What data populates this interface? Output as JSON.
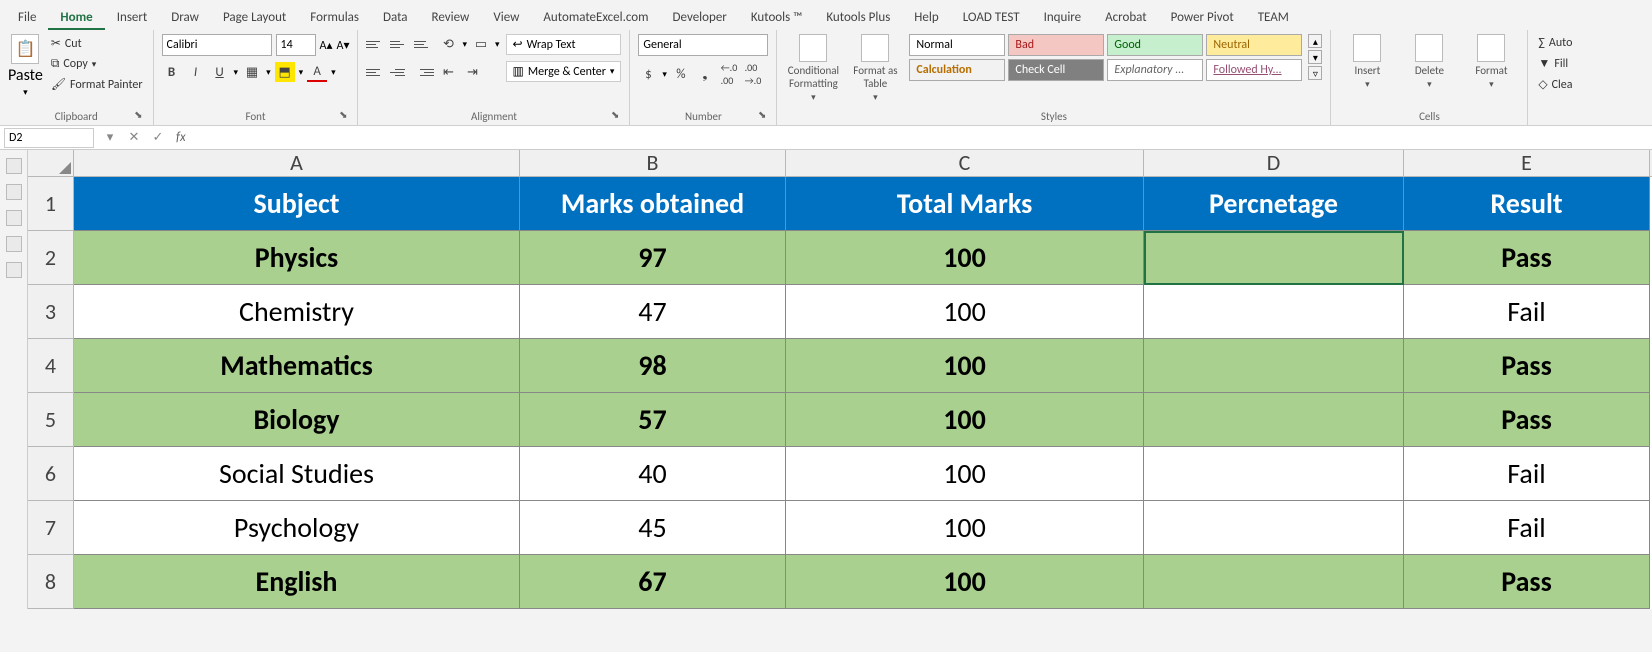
{
  "tabs": [
    "File",
    "Home",
    "Insert",
    "Draw",
    "Page Layout",
    "Formulas",
    "Data",
    "Review",
    "View",
    "AutomateExcel.com",
    "Developer",
    "Kutools ™",
    "Kutools Plus",
    "Help",
    "LOAD TEST",
    "Inquire",
    "Acrobat",
    "Power Pivot",
    "TEAM"
  ],
  "active_tab": "Home",
  "clipboard": {
    "paste": "Paste",
    "cut": "Cut",
    "copy": "Copy",
    "painter": "Format Painter",
    "label": "Clipboard"
  },
  "font": {
    "name": "Calibri",
    "size": "14",
    "label": "Font"
  },
  "alignment": {
    "wrap": "Wrap Text",
    "merge": "Merge & Center",
    "label": "Alignment"
  },
  "number": {
    "format": "General",
    "label": "Number"
  },
  "styles": {
    "cond": "Conditional Formatting",
    "fmt_table": "Format as Table",
    "normal": "Normal",
    "bad": "Bad",
    "good": "Good",
    "neutral": "Neutral",
    "calc": "Calculation",
    "check": "Check Cell",
    "expl": "Explanatory ...",
    "follow": "Followed Hy...",
    "label": "Styles"
  },
  "cells": {
    "insert": "Insert",
    "delete": "Delete",
    "format": "Format",
    "label": "Cells"
  },
  "editing": {
    "autosum": "Auto",
    "fill": "Fill",
    "clear": "Clea"
  },
  "namebox": "D2",
  "formula": "",
  "columns": [
    "A",
    "B",
    "C",
    "D",
    "E"
  ],
  "header_row": [
    "Subject",
    "Marks obtained",
    "Total Marks",
    "Percnetage",
    "Result"
  ],
  "rows": [
    {
      "n": "2",
      "cells": [
        "Physics",
        "97",
        "100",
        "",
        "Pass"
      ],
      "pass": true
    },
    {
      "n": "3",
      "cells": [
        "Chemistry",
        "47",
        "100",
        "",
        "Fail"
      ],
      "pass": false
    },
    {
      "n": "4",
      "cells": [
        "Mathematics",
        "98",
        "100",
        "",
        "Pass"
      ],
      "pass": true
    },
    {
      "n": "5",
      "cells": [
        "Biology",
        "57",
        "100",
        "",
        "Pass"
      ],
      "pass": true
    },
    {
      "n": "6",
      "cells": [
        "Social Studies",
        "40",
        "100",
        "",
        "Fail"
      ],
      "pass": false
    },
    {
      "n": "7",
      "cells": [
        "Psychology",
        "45",
        "100",
        "",
        "Fail"
      ],
      "pass": false
    },
    {
      "n": "8",
      "cells": [
        "English",
        "67",
        "100",
        "",
        "Pass"
      ],
      "pass": true
    }
  ],
  "selected": {
    "row": "2",
    "col": "D"
  }
}
